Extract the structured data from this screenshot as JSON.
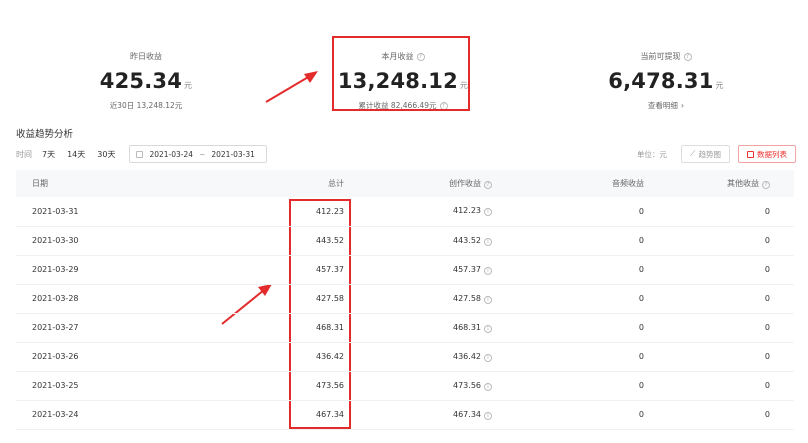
{
  "stats": {
    "yesterday": {
      "label": "昨日收益",
      "value": "425.34",
      "unit": "元",
      "sub": "近30日 13,248.12元"
    },
    "month": {
      "label": "本月收益",
      "value": "13,248.12",
      "unit": "元",
      "sub": "累计收益 82,466.49元"
    },
    "withdrawable": {
      "label": "当前可提现",
      "value": "6,478.31",
      "unit": "元",
      "sub": "查看明细",
      "sub_arrow": "›"
    }
  },
  "section_title": "收益趋势分析",
  "filters": {
    "label": "时间",
    "ranges": [
      "7天",
      "14天",
      "30天"
    ],
    "date_start": "2021-03-24",
    "date_sep": "~",
    "date_end": "2021-03-31"
  },
  "controls": {
    "unit_label": "单位：元",
    "trend_button": "趋势图",
    "list_button": "数据列表"
  },
  "table": {
    "headers": {
      "date": "日期",
      "total": "总计",
      "creation": "创作收益",
      "audio": "音频收益",
      "other": "其他收益"
    },
    "rows": [
      {
        "date": "2021-03-31",
        "total": "412.23",
        "creation": "412.23",
        "audio": "0",
        "other": "0"
      },
      {
        "date": "2021-03-30",
        "total": "443.52",
        "creation": "443.52",
        "audio": "0",
        "other": "0"
      },
      {
        "date": "2021-03-29",
        "total": "457.37",
        "creation": "457.37",
        "audio": "0",
        "other": "0"
      },
      {
        "date": "2021-03-28",
        "total": "427.58",
        "creation": "427.58",
        "audio": "0",
        "other": "0"
      },
      {
        "date": "2021-03-27",
        "total": "468.31",
        "creation": "468.31",
        "audio": "0",
        "other": "0"
      },
      {
        "date": "2021-03-26",
        "total": "436.42",
        "creation": "436.42",
        "audio": "0",
        "other": "0"
      },
      {
        "date": "2021-03-25",
        "total": "473.56",
        "creation": "473.56",
        "audio": "0",
        "other": "0"
      },
      {
        "date": "2021-03-24",
        "total": "467.34",
        "creation": "467.34",
        "audio": "0",
        "other": "0"
      }
    ]
  },
  "colors": {
    "highlight": "#e32b2b",
    "accent": "#ee3333"
  },
  "icons": {
    "help": "help-circle-icon",
    "calendar": "calendar-icon",
    "trend": "trend-chart-icon",
    "list": "list-icon"
  }
}
